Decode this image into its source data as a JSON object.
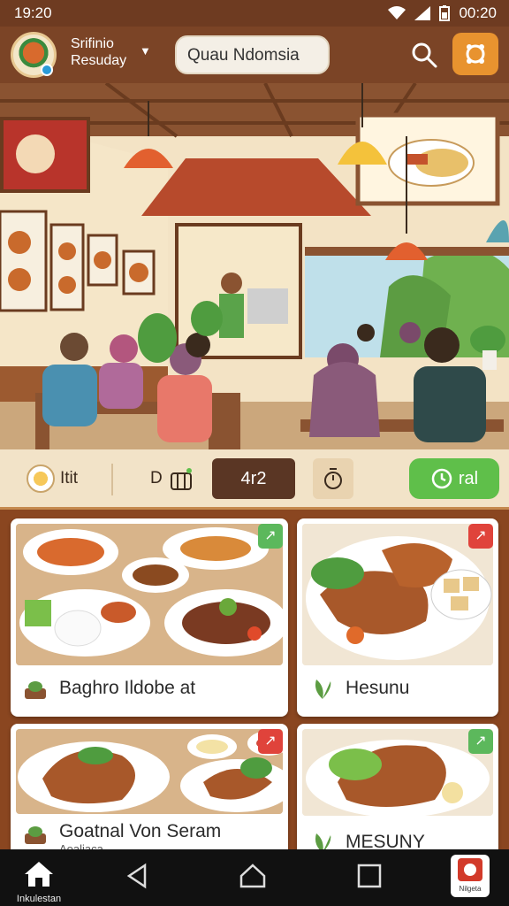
{
  "status_bar": {
    "time_left": "19:20",
    "time_right": "00:20"
  },
  "header": {
    "brand_line1": "Srifinio",
    "brand_line2": "Resuday",
    "search_value": "Quau Ndomsia"
  },
  "categories": {
    "item1_label": "Itit",
    "item2_label": "D",
    "active_label": "4r2",
    "green_label": "ral"
  },
  "cards": [
    {
      "title": "Baghro Ildobe at",
      "badge_color": "#5cb85c"
    },
    {
      "title": "Hesunu",
      "badge_color": "#e0433b"
    },
    {
      "title": "Goatnal Von Seram",
      "subtitle": "Aoaliaca",
      "badge_color": "#e0433b"
    },
    {
      "title": "MESUNY",
      "badge_color": "#5cb85c"
    }
  ],
  "nav": {
    "home_label": "Inkulestan",
    "app_label": "Nilgeta"
  },
  "colors": {
    "brand_brown": "#7b4426",
    "accent_orange": "#e8932f",
    "accent_green": "#5fbf4a"
  }
}
